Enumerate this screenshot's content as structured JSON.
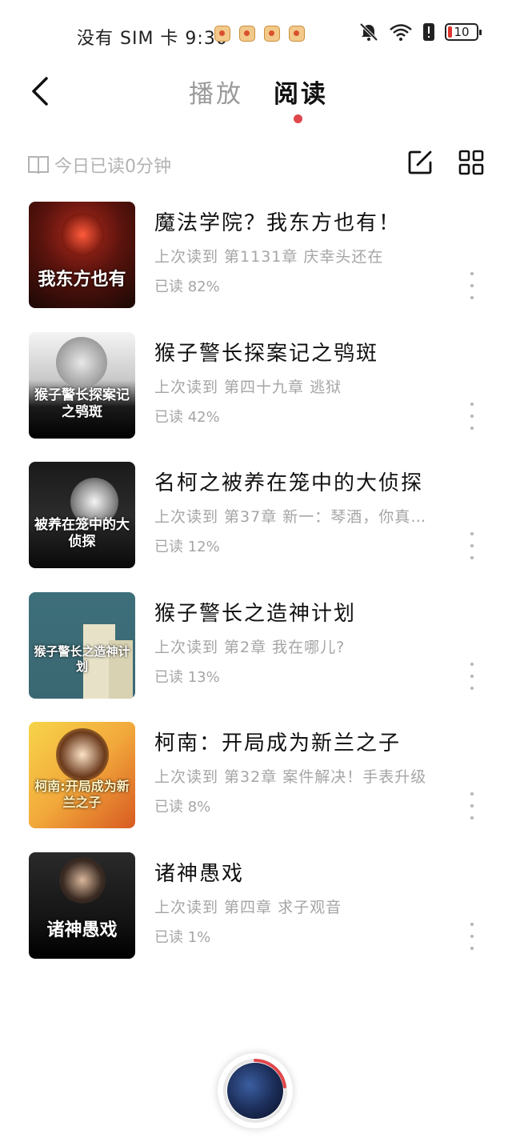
{
  "status_bar": {
    "carrier_time": "没有 SIM 卡 9:30",
    "battery": "10"
  },
  "header": {
    "tabs": [
      {
        "label": "播放",
        "active": false
      },
      {
        "label": "阅读",
        "active": true
      }
    ],
    "accent_color": "#e0474c"
  },
  "toolbar": {
    "today_read": "今日已读0分钟"
  },
  "books": [
    {
      "title": "魔法学院？我东方也有！",
      "last_read": "上次读到 第1131章 庆幸头还在",
      "progress": "已读 82%",
      "progress_value": 0.82,
      "cover_text": "我东方也有"
    },
    {
      "title": "猴子警长探案记之鸮斑",
      "last_read": "上次读到 第四十九章 逃狱",
      "progress": "已读 42%",
      "progress_value": 0.42,
      "cover_text": "猴子警长探案记之鸮斑"
    },
    {
      "title": "名柯之被养在笼中的大侦探",
      "last_read": "上次读到 第37章 新一：琴酒，你真…",
      "progress": "已读 12%",
      "progress_value": 0.12,
      "cover_text": "被养在笼中的大侦探"
    },
    {
      "title": "猴子警长之造神计划",
      "last_read": "上次读到 第2章 我在哪儿?",
      "progress": "已读 13%",
      "progress_value": 0.13,
      "cover_text": "猴子警长之造神计划"
    },
    {
      "title": "柯南：开局成为新兰之子",
      "last_read": "上次读到 第32章 案件解决！手表升级",
      "progress": "已读 8%",
      "progress_value": 0.08,
      "cover_text": "柯南:开局成为新兰之子"
    },
    {
      "title": "诸神愚戏",
      "last_read": "上次读到 第四章 求子观音",
      "progress": "已读 1%",
      "progress_value": 0.01,
      "cover_text": "诸神愚戏"
    }
  ]
}
